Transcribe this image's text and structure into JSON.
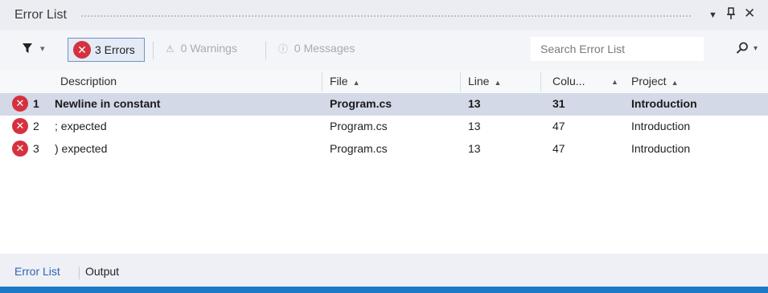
{
  "window": {
    "title": "Error List",
    "menu_icon": "chevron-down-icon",
    "pin_icon": "pin-icon",
    "close_icon": "close-icon"
  },
  "toolbar": {
    "filter_icon": "filter-icon",
    "errors_label": "3 Errors",
    "warnings_label": "0 Warnings",
    "messages_label": "0 Messages",
    "search_placeholder": "Search Error List",
    "search_icon": "search-icon"
  },
  "columns": [
    "Description",
    "File",
    "Line",
    "Colu...",
    "Project"
  ],
  "rows": [
    {
      "num": "1",
      "description": "Newline in constant",
      "file": "Program.cs",
      "line": "13",
      "column": "31",
      "project": "Introduction"
    },
    {
      "num": "2",
      "description": "; expected",
      "file": "Program.cs",
      "line": "13",
      "column": "47",
      "project": "Introduction"
    },
    {
      "num": "3",
      "description": ") expected",
      "file": "Program.cs",
      "line": "13",
      "column": "47",
      "project": "Introduction"
    }
  ],
  "bottom_tabs": [
    "Error List",
    "Output"
  ],
  "colors": {
    "error_red": "#d6313e",
    "selection": "#d3d9e7",
    "accent_bar": "#1c79c8"
  }
}
